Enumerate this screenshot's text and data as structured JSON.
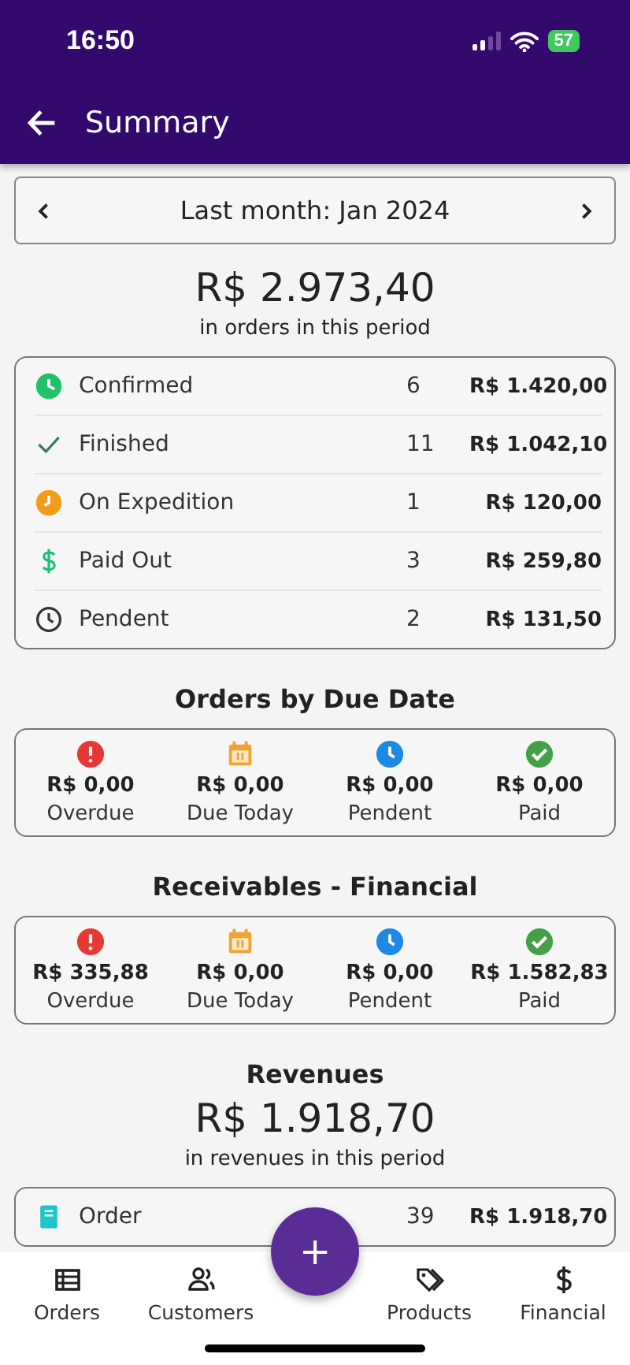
{
  "status_bar": {
    "time": "16:50",
    "battery": "57"
  },
  "app_bar": {
    "title": "Summary"
  },
  "period": {
    "label": "Last month: Jan 2024"
  },
  "orders_total": {
    "amount": "R$ 2.973,40",
    "caption": "in orders in this period"
  },
  "order_statuses": [
    {
      "kind": "confirmed",
      "label": "Confirmed",
      "count": "6",
      "amount": "R$ 1.420,00"
    },
    {
      "kind": "finished",
      "label": "Finished",
      "count": "11",
      "amount": "R$ 1.042,10"
    },
    {
      "kind": "expedition",
      "label": "On Expedition",
      "count": "1",
      "amount": "R$ 120,00"
    },
    {
      "kind": "paid_out",
      "label": "Paid Out",
      "count": "3",
      "amount": "R$ 259,80"
    },
    {
      "kind": "pendent",
      "label": "Pendent",
      "count": "2",
      "amount": "R$ 131,50"
    }
  ],
  "sections": [
    {
      "title": "Orders by Due Date",
      "tiles": [
        {
          "kind": "overdue",
          "amount": "R$ 0,00",
          "label": "Overdue"
        },
        {
          "kind": "due_today",
          "amount": "R$ 0,00",
          "label": "Due Today"
        },
        {
          "kind": "pendent",
          "amount": "R$ 0,00",
          "label": "Pendent"
        },
        {
          "kind": "paid",
          "amount": "R$ 0,00",
          "label": "Paid"
        }
      ]
    },
    {
      "title": "Receivables - Financial",
      "tiles": [
        {
          "kind": "overdue",
          "amount": "R$ 335,88",
          "label": "Overdue"
        },
        {
          "kind": "due_today",
          "amount": "R$ 0,00",
          "label": "Due Today"
        },
        {
          "kind": "pendent",
          "amount": "R$ 0,00",
          "label": "Pendent"
        },
        {
          "kind": "paid",
          "amount": "R$ 1.582,83",
          "label": "Paid"
        }
      ]
    }
  ],
  "revenues": {
    "title": "Revenues",
    "amount": "R$ 1.918,70",
    "caption": "in revenues in this period",
    "rows": [
      {
        "kind": "order",
        "label": "Order",
        "count": "39",
        "amount": "R$ 1.918,70"
      }
    ]
  },
  "fab": {
    "label": "+"
  },
  "bottom_nav": [
    {
      "kind": "orders",
      "label": "Orders"
    },
    {
      "kind": "customers",
      "label": "Customers"
    },
    {
      "kind": "products",
      "label": "Products"
    },
    {
      "kind": "financial",
      "label": "Financial"
    }
  ]
}
